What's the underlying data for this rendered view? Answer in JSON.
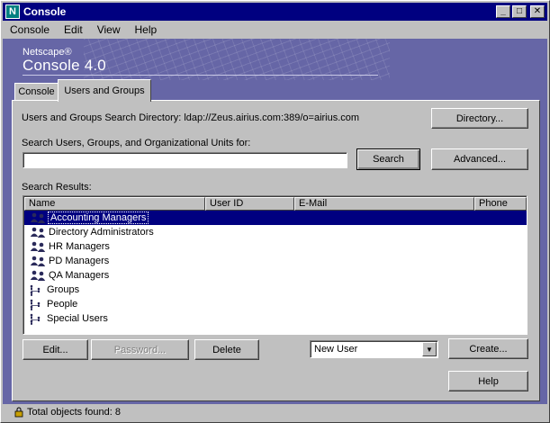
{
  "window": {
    "title": "Console",
    "app_icon": "N"
  },
  "menubar": {
    "items": [
      "Console",
      "Edit",
      "View",
      "Help"
    ]
  },
  "banner": {
    "brand_small": "Netscape®",
    "brand_big": "Console 4.0"
  },
  "tabs": [
    {
      "label": "Console",
      "selected": false
    },
    {
      "label": "Users and Groups",
      "selected": true
    }
  ],
  "directory": {
    "label": "Users and Groups Search Directory: ldap://Zeus.airius.com:389/o=airius.com",
    "button": "Directory..."
  },
  "search": {
    "label": "Search Users, Groups, and Organizational Units for:",
    "value": "",
    "search_button": "Search",
    "advanced_button": "Advanced..."
  },
  "results": {
    "label": "Search Results:",
    "columns": [
      "Name",
      "User ID",
      "E-Mail",
      "Phone"
    ],
    "rows": [
      {
        "name": "Accounting Managers",
        "icon": "group-icon",
        "selected": true
      },
      {
        "name": "Directory Administrators",
        "icon": "group-icon",
        "selected": false
      },
      {
        "name": "HR Managers",
        "icon": "group-icon",
        "selected": false
      },
      {
        "name": "PD Managers",
        "icon": "group-icon",
        "selected": false
      },
      {
        "name": "QA Managers",
        "icon": "group-icon",
        "selected": false
      },
      {
        "name": "Groups",
        "icon": "org-unit-icon",
        "selected": false
      },
      {
        "name": "People",
        "icon": "org-unit-icon",
        "selected": false
      },
      {
        "name": "Special Users",
        "icon": "org-unit-icon",
        "selected": false
      }
    ]
  },
  "actions": {
    "edit": "Edit...",
    "password": "Password...",
    "delete": "Delete",
    "new_type": "New User",
    "create": "Create...",
    "help": "Help"
  },
  "status": {
    "text": "Total objects found: 8"
  },
  "colors": {
    "banner": "#6666a6",
    "selection": "#000080",
    "titlebar": "#000080"
  }
}
